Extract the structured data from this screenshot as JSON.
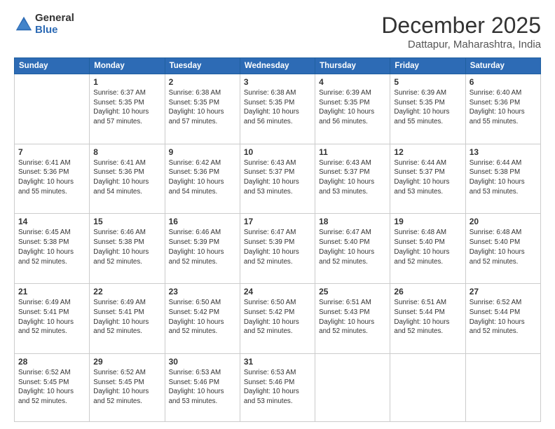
{
  "logo": {
    "general": "General",
    "blue": "Blue"
  },
  "header": {
    "month": "December 2025",
    "location": "Dattapur, Maharashtra, India"
  },
  "weekdays": [
    "Sunday",
    "Monday",
    "Tuesday",
    "Wednesday",
    "Thursday",
    "Friday",
    "Saturday"
  ],
  "weeks": [
    [
      {
        "day": "",
        "info": ""
      },
      {
        "day": "1",
        "info": "Sunrise: 6:37 AM\nSunset: 5:35 PM\nDaylight: 10 hours\nand 57 minutes."
      },
      {
        "day": "2",
        "info": "Sunrise: 6:38 AM\nSunset: 5:35 PM\nDaylight: 10 hours\nand 57 minutes."
      },
      {
        "day": "3",
        "info": "Sunrise: 6:38 AM\nSunset: 5:35 PM\nDaylight: 10 hours\nand 56 minutes."
      },
      {
        "day": "4",
        "info": "Sunrise: 6:39 AM\nSunset: 5:35 PM\nDaylight: 10 hours\nand 56 minutes."
      },
      {
        "day": "5",
        "info": "Sunrise: 6:39 AM\nSunset: 5:35 PM\nDaylight: 10 hours\nand 55 minutes."
      },
      {
        "day": "6",
        "info": "Sunrise: 6:40 AM\nSunset: 5:36 PM\nDaylight: 10 hours\nand 55 minutes."
      }
    ],
    [
      {
        "day": "7",
        "info": "Sunrise: 6:41 AM\nSunset: 5:36 PM\nDaylight: 10 hours\nand 55 minutes."
      },
      {
        "day": "8",
        "info": "Sunrise: 6:41 AM\nSunset: 5:36 PM\nDaylight: 10 hours\nand 54 minutes."
      },
      {
        "day": "9",
        "info": "Sunrise: 6:42 AM\nSunset: 5:36 PM\nDaylight: 10 hours\nand 54 minutes."
      },
      {
        "day": "10",
        "info": "Sunrise: 6:43 AM\nSunset: 5:37 PM\nDaylight: 10 hours\nand 53 minutes."
      },
      {
        "day": "11",
        "info": "Sunrise: 6:43 AM\nSunset: 5:37 PM\nDaylight: 10 hours\nand 53 minutes."
      },
      {
        "day": "12",
        "info": "Sunrise: 6:44 AM\nSunset: 5:37 PM\nDaylight: 10 hours\nand 53 minutes."
      },
      {
        "day": "13",
        "info": "Sunrise: 6:44 AM\nSunset: 5:38 PM\nDaylight: 10 hours\nand 53 minutes."
      }
    ],
    [
      {
        "day": "14",
        "info": "Sunrise: 6:45 AM\nSunset: 5:38 PM\nDaylight: 10 hours\nand 52 minutes."
      },
      {
        "day": "15",
        "info": "Sunrise: 6:46 AM\nSunset: 5:38 PM\nDaylight: 10 hours\nand 52 minutes."
      },
      {
        "day": "16",
        "info": "Sunrise: 6:46 AM\nSunset: 5:39 PM\nDaylight: 10 hours\nand 52 minutes."
      },
      {
        "day": "17",
        "info": "Sunrise: 6:47 AM\nSunset: 5:39 PM\nDaylight: 10 hours\nand 52 minutes."
      },
      {
        "day": "18",
        "info": "Sunrise: 6:47 AM\nSunset: 5:40 PM\nDaylight: 10 hours\nand 52 minutes."
      },
      {
        "day": "19",
        "info": "Sunrise: 6:48 AM\nSunset: 5:40 PM\nDaylight: 10 hours\nand 52 minutes."
      },
      {
        "day": "20",
        "info": "Sunrise: 6:48 AM\nSunset: 5:40 PM\nDaylight: 10 hours\nand 52 minutes."
      }
    ],
    [
      {
        "day": "21",
        "info": "Sunrise: 6:49 AM\nSunset: 5:41 PM\nDaylight: 10 hours\nand 52 minutes."
      },
      {
        "day": "22",
        "info": "Sunrise: 6:49 AM\nSunset: 5:41 PM\nDaylight: 10 hours\nand 52 minutes."
      },
      {
        "day": "23",
        "info": "Sunrise: 6:50 AM\nSunset: 5:42 PM\nDaylight: 10 hours\nand 52 minutes."
      },
      {
        "day": "24",
        "info": "Sunrise: 6:50 AM\nSunset: 5:42 PM\nDaylight: 10 hours\nand 52 minutes."
      },
      {
        "day": "25",
        "info": "Sunrise: 6:51 AM\nSunset: 5:43 PM\nDaylight: 10 hours\nand 52 minutes."
      },
      {
        "day": "26",
        "info": "Sunrise: 6:51 AM\nSunset: 5:44 PM\nDaylight: 10 hours\nand 52 minutes."
      },
      {
        "day": "27",
        "info": "Sunrise: 6:52 AM\nSunset: 5:44 PM\nDaylight: 10 hours\nand 52 minutes."
      }
    ],
    [
      {
        "day": "28",
        "info": "Sunrise: 6:52 AM\nSunset: 5:45 PM\nDaylight: 10 hours\nand 52 minutes."
      },
      {
        "day": "29",
        "info": "Sunrise: 6:52 AM\nSunset: 5:45 PM\nDaylight: 10 hours\nand 52 minutes."
      },
      {
        "day": "30",
        "info": "Sunrise: 6:53 AM\nSunset: 5:46 PM\nDaylight: 10 hours\nand 53 minutes."
      },
      {
        "day": "31",
        "info": "Sunrise: 6:53 AM\nSunset: 5:46 PM\nDaylight: 10 hours\nand 53 minutes."
      },
      {
        "day": "",
        "info": ""
      },
      {
        "day": "",
        "info": ""
      },
      {
        "day": "",
        "info": ""
      }
    ]
  ]
}
